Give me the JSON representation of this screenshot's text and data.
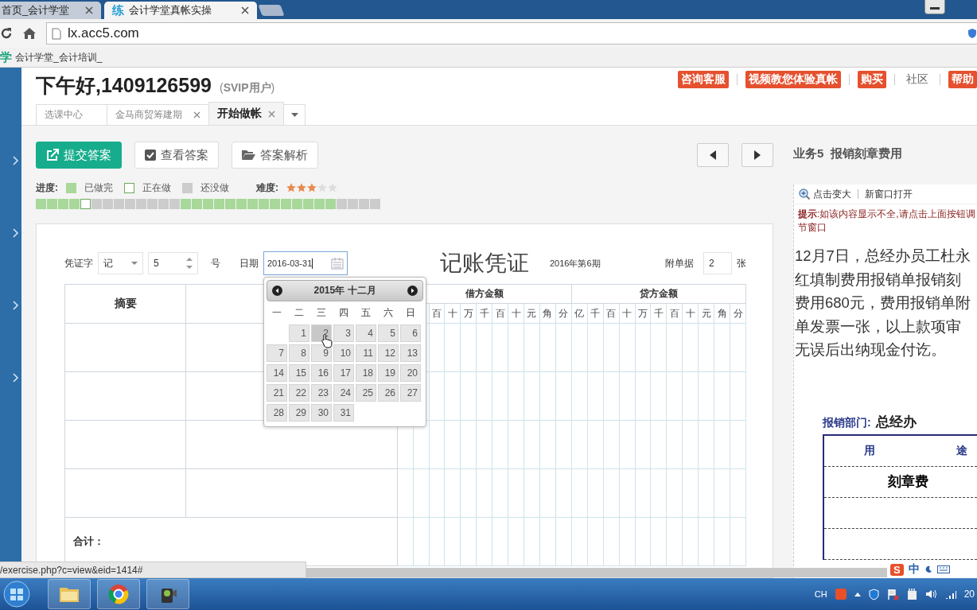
{
  "browser": {
    "tabs": [
      {
        "title": "首页_会计学堂",
        "selected": false
      },
      {
        "title": "会计学堂真帐实操",
        "selected": true,
        "badge": "练"
      }
    ],
    "url": "lx.acc5.com",
    "bookmark": {
      "badge": "学",
      "label": "会计学堂_会计培训_"
    }
  },
  "header": {
    "greeting": "下午好,1409126599",
    "user_level": "(**SVIP用户**)",
    "links": [
      {
        "label": "咨询客服",
        "kind": "badge"
      },
      {
        "label": "视频教您体验真帐",
        "kind": "badge"
      },
      {
        "label": "购买",
        "kind": "badge"
      },
      {
        "label": "社区",
        "kind": "plain"
      },
      {
        "label": "帮助",
        "kind": "badge"
      }
    ]
  },
  "page_tabs": [
    {
      "label": "选课中心",
      "closable": false,
      "selected": false
    },
    {
      "label": "金马商贸筹建期",
      "closable": true,
      "selected": false
    },
    {
      "label": "开始做帐",
      "closable": true,
      "selected": true
    }
  ],
  "toolbar": {
    "buttons": [
      {
        "label": "提交答案",
        "kind": "submit"
      },
      {
        "label": "查看答案",
        "kind": "view"
      },
      {
        "label": "答案解析",
        "kind": "explain"
      }
    ]
  },
  "progress": {
    "label": "进度:",
    "legend": [
      {
        "label": "已做完",
        "kind": "done"
      },
      {
        "label": "正在做",
        "kind": "current"
      },
      {
        "label": "还没做",
        "kind": "todo"
      }
    ],
    "difficulty_label": "难度:",
    "stars": 3,
    "squares": [
      {
        "kind": "done"
      },
      {
        "kind": "done"
      },
      {
        "kind": "done"
      },
      {
        "kind": "done"
      },
      {
        "kind": "current"
      },
      {
        "kind": "todo"
      },
      {
        "kind": "todo"
      },
      {
        "kind": "todo"
      },
      {
        "kind": "todo"
      },
      {
        "kind": "todo"
      },
      {
        "kind": "todo"
      },
      {
        "kind": "todo"
      },
      {
        "kind": "todo"
      },
      {
        "kind": "done"
      },
      {
        "kind": "done"
      },
      {
        "kind": "done"
      },
      {
        "kind": "done"
      },
      {
        "kind": "done"
      },
      {
        "kind": "done"
      },
      {
        "kind": "done"
      },
      {
        "kind": "done"
      },
      {
        "kind": "done"
      },
      {
        "kind": "done"
      },
      {
        "kind": "done"
      },
      {
        "kind": "done"
      },
      {
        "kind": "done"
      },
      {
        "kind": "done"
      },
      {
        "kind": "todo"
      },
      {
        "kind": "todo"
      },
      {
        "kind": "todo"
      },
      {
        "kind": "todo"
      }
    ]
  },
  "task_title": "业务5  报销刻章费用",
  "voucher": {
    "type_label": "凭证字",
    "type_value": "记",
    "number": "5",
    "number_unit": "号",
    "date_label": "日期",
    "date_value": "2016-03-31",
    "title": "记账凭证",
    "period": "2016年第6期",
    "attachments_label": "附单据",
    "attachments": "2",
    "attachments_unit": "张",
    "summary_header": "摘要",
    "debit_header": "借方金额",
    "credit_header": "贷方金额",
    "debit_digits": [
      "百",
      "十",
      "万",
      "千",
      "百",
      "十",
      "元",
      "角",
      "分"
    ],
    "credit_digits": [
      "亿",
      "千",
      "百",
      "十",
      "万",
      "千",
      "百",
      "十",
      "元",
      "角",
      "分"
    ],
    "total_label": "合计："
  },
  "calendar": {
    "title": "2015年 十二月",
    "weekdays": [
      "一",
      "二",
      "三",
      "四",
      "五",
      "六",
      "日"
    ],
    "days": [
      {
        "day": "1",
        "hovered": false
      },
      {
        "day": "2",
        "hovered": true
      },
      {
        "day": "3",
        "hovered": false
      },
      {
        "day": "4",
        "hovered": false
      },
      {
        "day": "5",
        "hovered": false
      },
      {
        "day": "6",
        "hovered": false
      },
      {
        "day": "7",
        "hovered": false
      },
      {
        "day": "8",
        "hovered": false
      },
      {
        "day": "9",
        "hovered": false
      },
      {
        "day": "10",
        "hovered": false
      },
      {
        "day": "11",
        "hovered": false
      },
      {
        "day": "12",
        "hovered": false
      },
      {
        "day": "13",
        "hovered": false
      },
      {
        "day": "14",
        "hovered": false
      },
      {
        "day": "15",
        "hovered": false
      },
      {
        "day": "16",
        "hovered": false
      },
      {
        "day": "17",
        "hovered": false
      },
      {
        "day": "18",
        "hovered": false
      },
      {
        "day": "19",
        "hovered": false
      },
      {
        "day": "20",
        "hovered": false
      },
      {
        "day": "21",
        "hovered": false
      },
      {
        "day": "22",
        "hovered": false
      },
      {
        "day": "23",
        "hovered": false
      },
      {
        "day": "24",
        "hovered": false
      },
      {
        "day": "25",
        "hovered": false
      },
      {
        "day": "26",
        "hovered": false
      },
      {
        "day": "27",
        "hovered": false
      },
      {
        "day": "28",
        "hovered": false
      },
      {
        "day": "29",
        "hovered": false
      },
      {
        "day": "30",
        "hovered": false
      },
      {
        "day": "31",
        "hovered": false
      }
    ]
  },
  "right_panel": {
    "zoom_label": "点击变大",
    "new_window_label": "新窗口打开",
    "hint_lines": [
      "**提示**:如该内容显示不全,请点击上面按钮调",
      "节窗口"
    ],
    "description_lines": [
      "12月7日，总经办员工杜永",
      "红填制费用报销单报销刻",
      "费用680元，费用报销单附",
      "单发票一张，以上款项审",
      "无误后出纳现金付讫。"
    ],
    "form": {
      "department_label": "报销部门:",
      "department": "总经办",
      "column_1": "用",
      "column_2": "途",
      "item": "刻章费"
    }
  },
  "status_url": "/exercise.php?c=view&eid=1414#",
  "ime": {
    "badge": "S",
    "label": "中"
  },
  "taskbar": {
    "language": "CH",
    "clock": "20"
  }
}
